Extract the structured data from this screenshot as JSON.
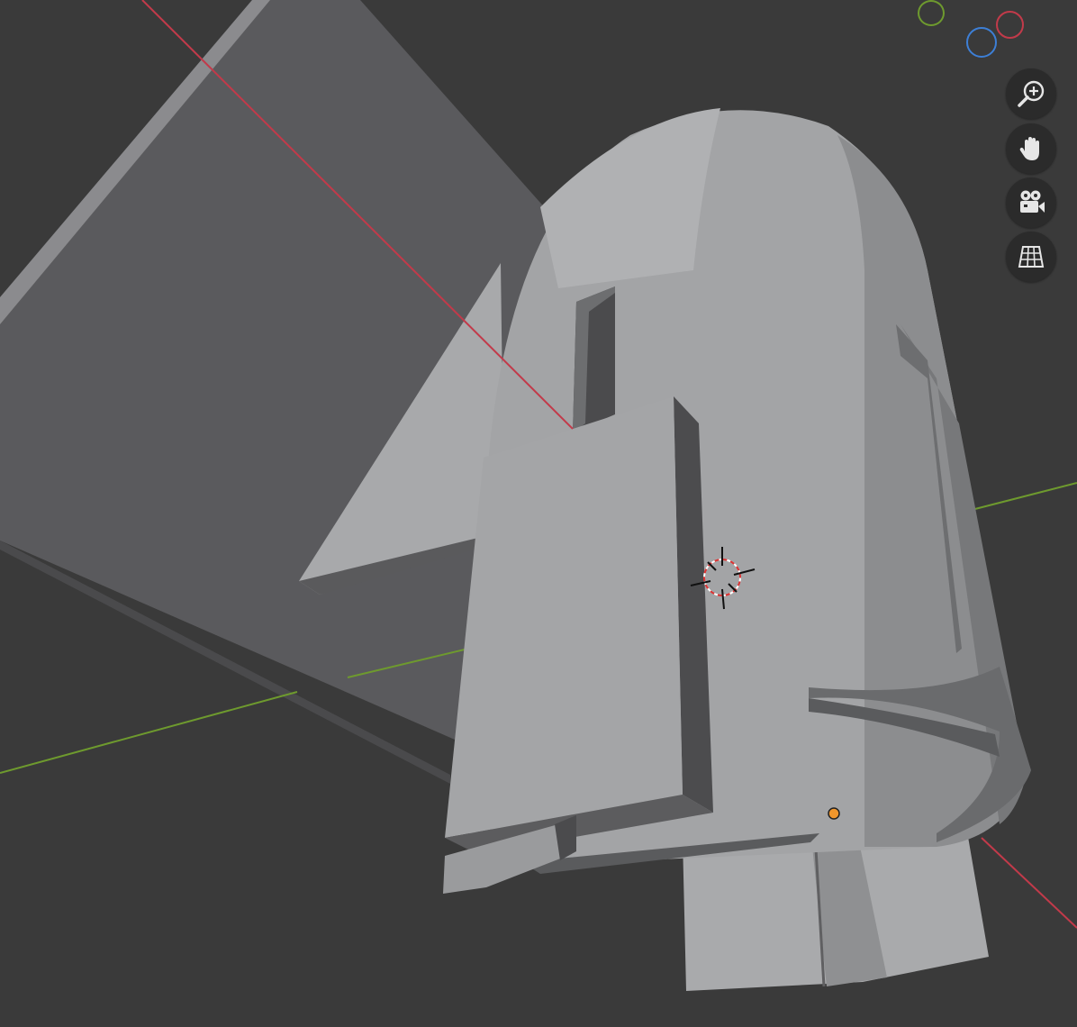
{
  "viewport": {
    "background": "#3a3a3a",
    "axis_colors": {
      "x": "#c23a4a",
      "y": "#6e9a2e",
      "z": "#3d7fd6"
    }
  },
  "gizmo": [
    {
      "name": "y-axis-icon",
      "color": "#6e9a2e"
    },
    {
      "name": "x-axis-icon",
      "color": "#c23a4a"
    },
    {
      "name": "z-axis-icon",
      "color": "#3d7fd6"
    }
  ],
  "nav_buttons": [
    {
      "name": "zoom-icon"
    },
    {
      "name": "pan-hand-icon"
    },
    {
      "name": "camera-view-icon"
    },
    {
      "name": "ortho-grid-icon"
    }
  ],
  "scene": {
    "plane_color": "#5a5a5d",
    "mesh_light": "#a6a7a9",
    "mesh_mid": "#8e8f91",
    "mesh_dark": "#4b4b4d",
    "origin_color": "#f0962c"
  }
}
